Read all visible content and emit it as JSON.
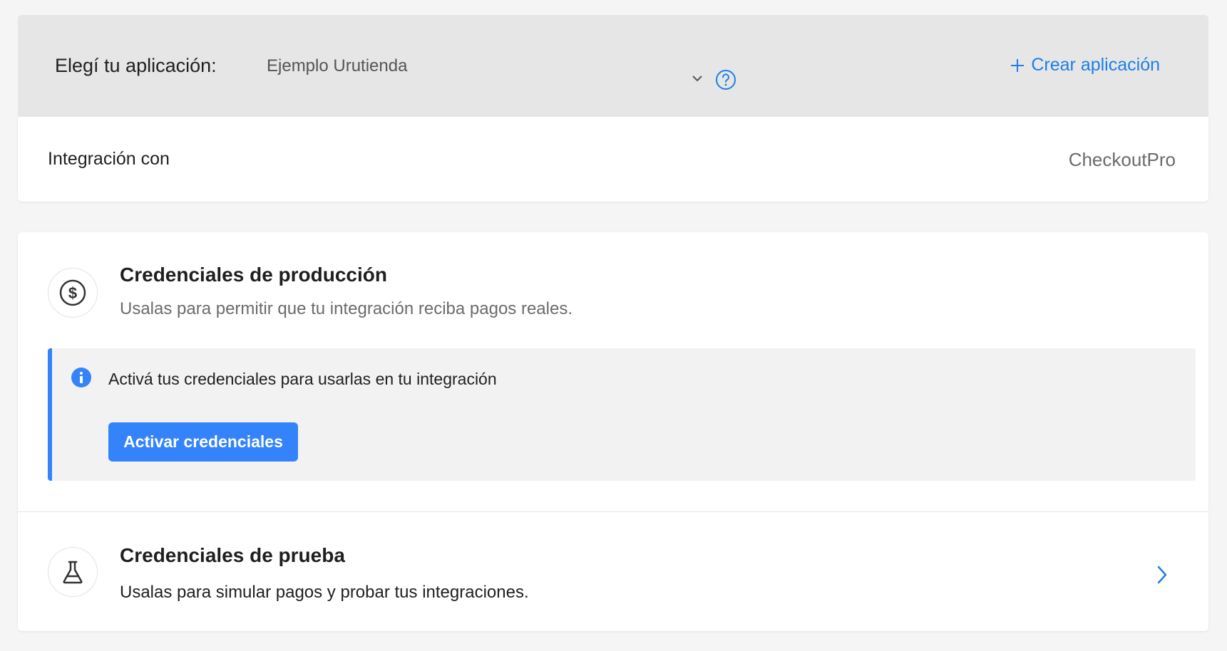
{
  "app_selector": {
    "label": "Elegí tu aplicación:",
    "selected_value": "Ejemplo Urutienda",
    "create_label": "Crear aplicación"
  },
  "integration": {
    "label": "Integración con",
    "value": "CheckoutPro"
  },
  "production": {
    "title": "Credenciales de producción",
    "subtitle": "Usalas para permitir que tu integración reciba pagos reales.",
    "info_text": "Activá tus credenciales para usarlas en tu integración",
    "button_label": "Activar credenciales"
  },
  "test": {
    "title": "Credenciales de prueba",
    "subtitle": "Usalas para simular pagos y probar tus integraciones."
  },
  "colors": {
    "accent": "#3483fa",
    "link": "#1e7fe6",
    "app_bar_bg": "#e6e6e6",
    "page_bg": "#f5f5f5"
  },
  "icons": {
    "dropdown": "chevron-down-icon",
    "help": "help-circle-icon",
    "create": "plus-icon",
    "production": "dollar-circle-icon",
    "info": "info-icon",
    "test": "flask-icon",
    "navigate": "chevron-right-icon"
  }
}
